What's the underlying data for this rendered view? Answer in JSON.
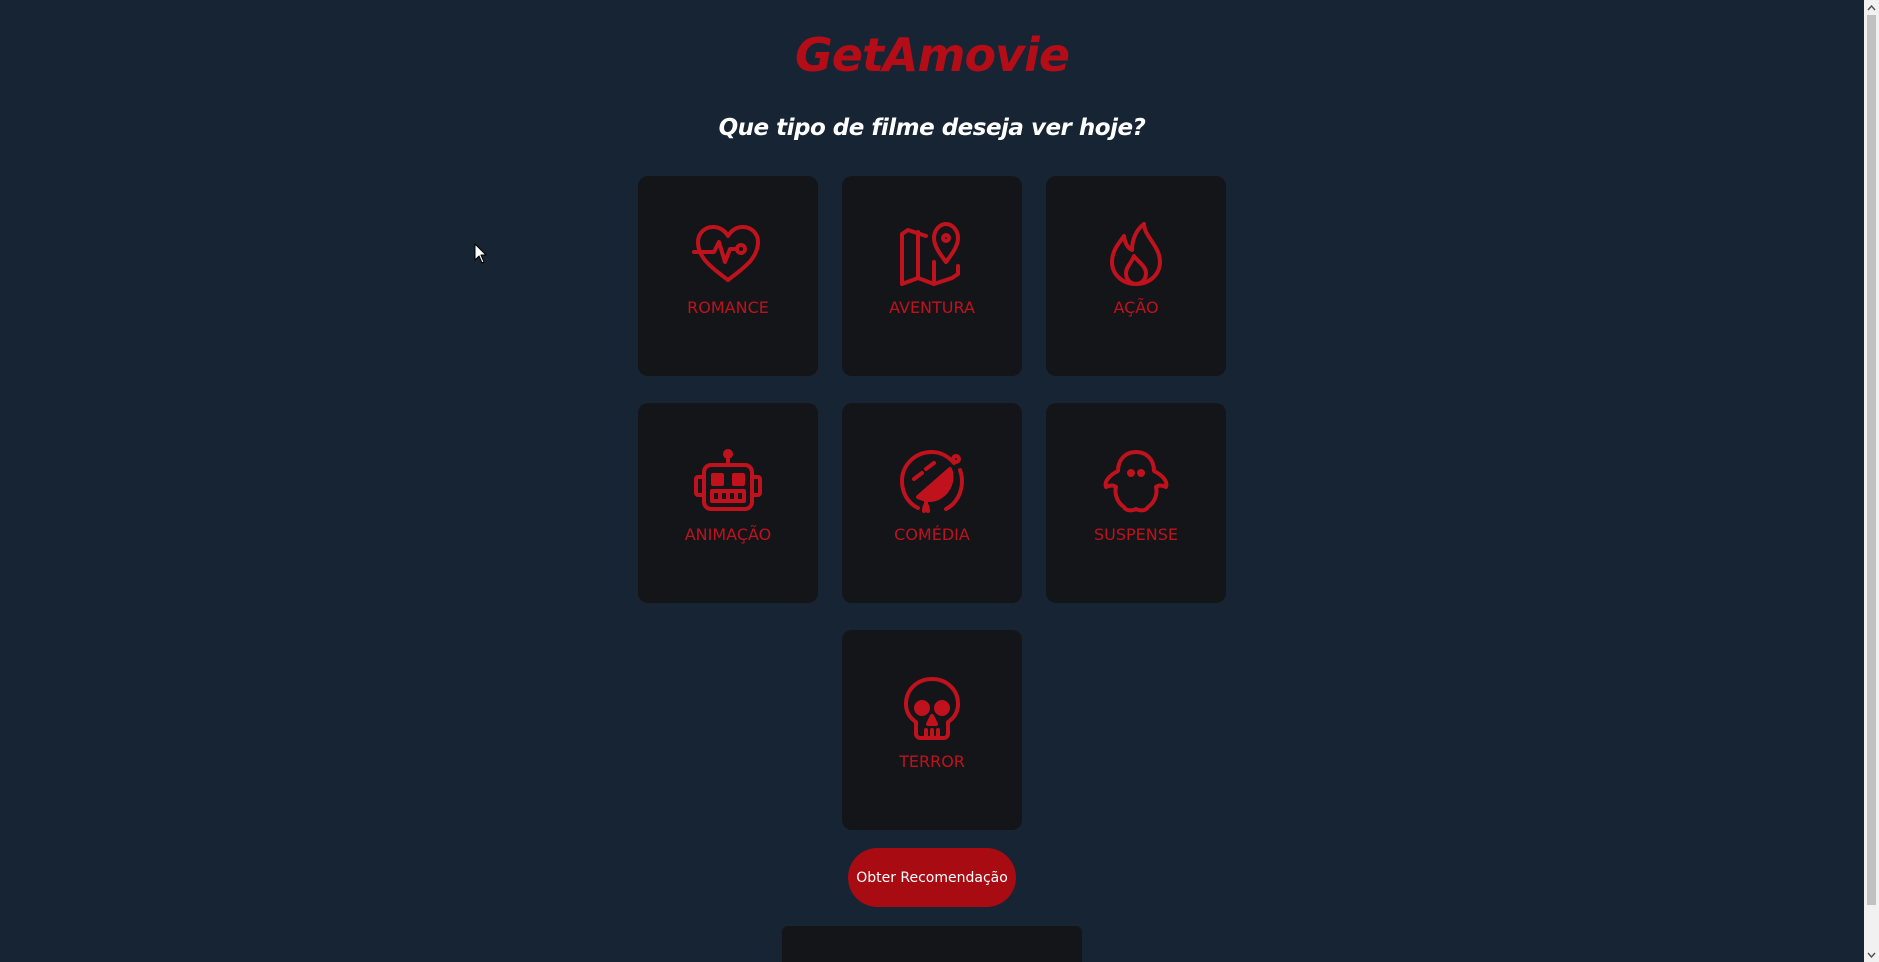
{
  "header": {
    "logo": "GetAmovie",
    "subtitle": "Que tipo de filme deseja ver hoje?"
  },
  "genres": [
    {
      "label": "ROMANCE",
      "icon": "heart-pulse-icon"
    },
    {
      "label": "AVENTURA",
      "icon": "map-pin-icon"
    },
    {
      "label": "AÇÃO",
      "icon": "flame-icon"
    },
    {
      "label": "ANIMAÇÃO",
      "icon": "robot-icon"
    },
    {
      "label": "COMÉDIA",
      "icon": "laughing-face-icon"
    },
    {
      "label": "SUSPENSE",
      "icon": "ghost-icon"
    },
    {
      "label": "TERROR",
      "icon": "skull-icon"
    }
  ],
  "actions": {
    "recommend_label": "Obter Recomendação"
  },
  "colors": {
    "background": "#172433",
    "card": "#141519",
    "accent": "#b50d17",
    "button": "#a90b13",
    "text": "#ffffff"
  }
}
